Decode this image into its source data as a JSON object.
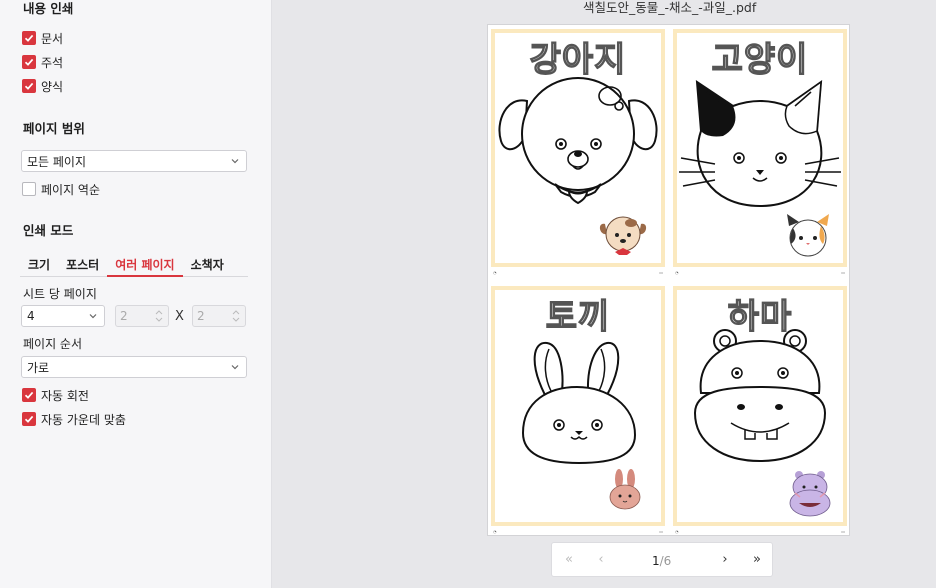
{
  "print_content": {
    "title": "내용 인쇄",
    "items": [
      {
        "label": "문서",
        "checked": true
      },
      {
        "label": "주석",
        "checked": true
      },
      {
        "label": "양식",
        "checked": true
      }
    ]
  },
  "page_range": {
    "title": "페이지 범위",
    "selected": "모든 페이지",
    "reverse_label": "페이지 역순",
    "reverse_checked": false
  },
  "print_mode": {
    "title": "인쇄 모드",
    "tabs": [
      {
        "label": "크기"
      },
      {
        "label": "포스터"
      },
      {
        "label": "여러 페이지",
        "active": true
      },
      {
        "label": "소책자"
      }
    ],
    "sheets_label": "시트 당 페이지",
    "sheets_value": "4",
    "cols": "2",
    "rows": "2",
    "x_sep": "X",
    "order_label": "페이지 순서",
    "order_value": "가로",
    "auto_rotate_label": "자동 회전",
    "auto_center_label": "자동 가운데 맞춤"
  },
  "preview": {
    "filename": "색칠도안_동물_-채소_-과일_.pdf",
    "pages": [
      {
        "title": "강아지"
      },
      {
        "title": "고양이"
      },
      {
        "title": "토끼"
      },
      {
        "title": "하마"
      }
    ]
  },
  "pager": {
    "current": "1",
    "total": "/6"
  },
  "colors": {
    "accent": "#d9363e",
    "frame": "#fbe9bf"
  }
}
